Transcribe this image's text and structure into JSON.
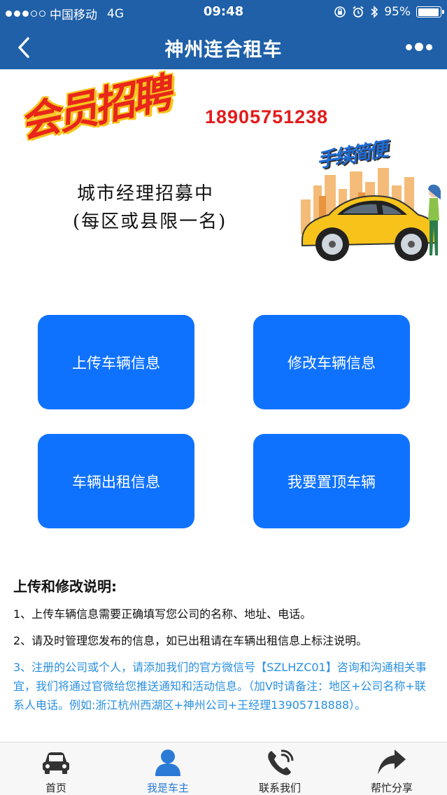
{
  "status_bar": {
    "carrier": "中国移动",
    "network": "4G",
    "time": "09:48",
    "battery": "95%",
    "signal_bars_filled": 3,
    "signal_bars_total": 5,
    "battery_level": 0.95
  },
  "header": {
    "title": "神州连合租车",
    "back_icon": "chevron-left-icon",
    "more_icon": "more-dots-icon",
    "color": "#1f60a8"
  },
  "banner": {
    "recruit_text": "会员招聘",
    "phone": "18905751238",
    "city_manager": "城市经理招募中",
    "limit_note": "(每区或县限一名)",
    "handy_text": "手续简便"
  },
  "actions": [
    {
      "label": "上传车辆信息"
    },
    {
      "label": "修改车辆信息"
    },
    {
      "label": "车辆出租信息"
    },
    {
      "label": "我要置顶车辆"
    }
  ],
  "notes": {
    "heading": "上传和修改说明:",
    "item1": "1、上传车辆信息需要正确填写您公司的名称、地址、电话。",
    "item2": "2、请及时管理您发布的信息，如已出租请在车辆出租信息上标注说明。",
    "item3": "3、注册的公司或个人，请添加我们的官方微信号【SZLHZC01】咨询和沟通相关事宜，我们将通过官微给您推送通知和活动信息。（加V时请备注：地区+公司名称+联系人电话。例如:浙江杭州西湖区+神州公司+王经理13905718888）。",
    "accent_color": "#2a8fe0"
  },
  "tabbar": {
    "tabs": [
      {
        "label": "首页",
        "icon": "car-icon"
      },
      {
        "label": "我是车主",
        "icon": "user-icon"
      },
      {
        "label": "联系我们",
        "icon": "phone-icon"
      },
      {
        "label": "帮忙分享",
        "icon": "share-icon"
      }
    ],
    "active_index": 1,
    "active_color": "#2a7ad6"
  }
}
